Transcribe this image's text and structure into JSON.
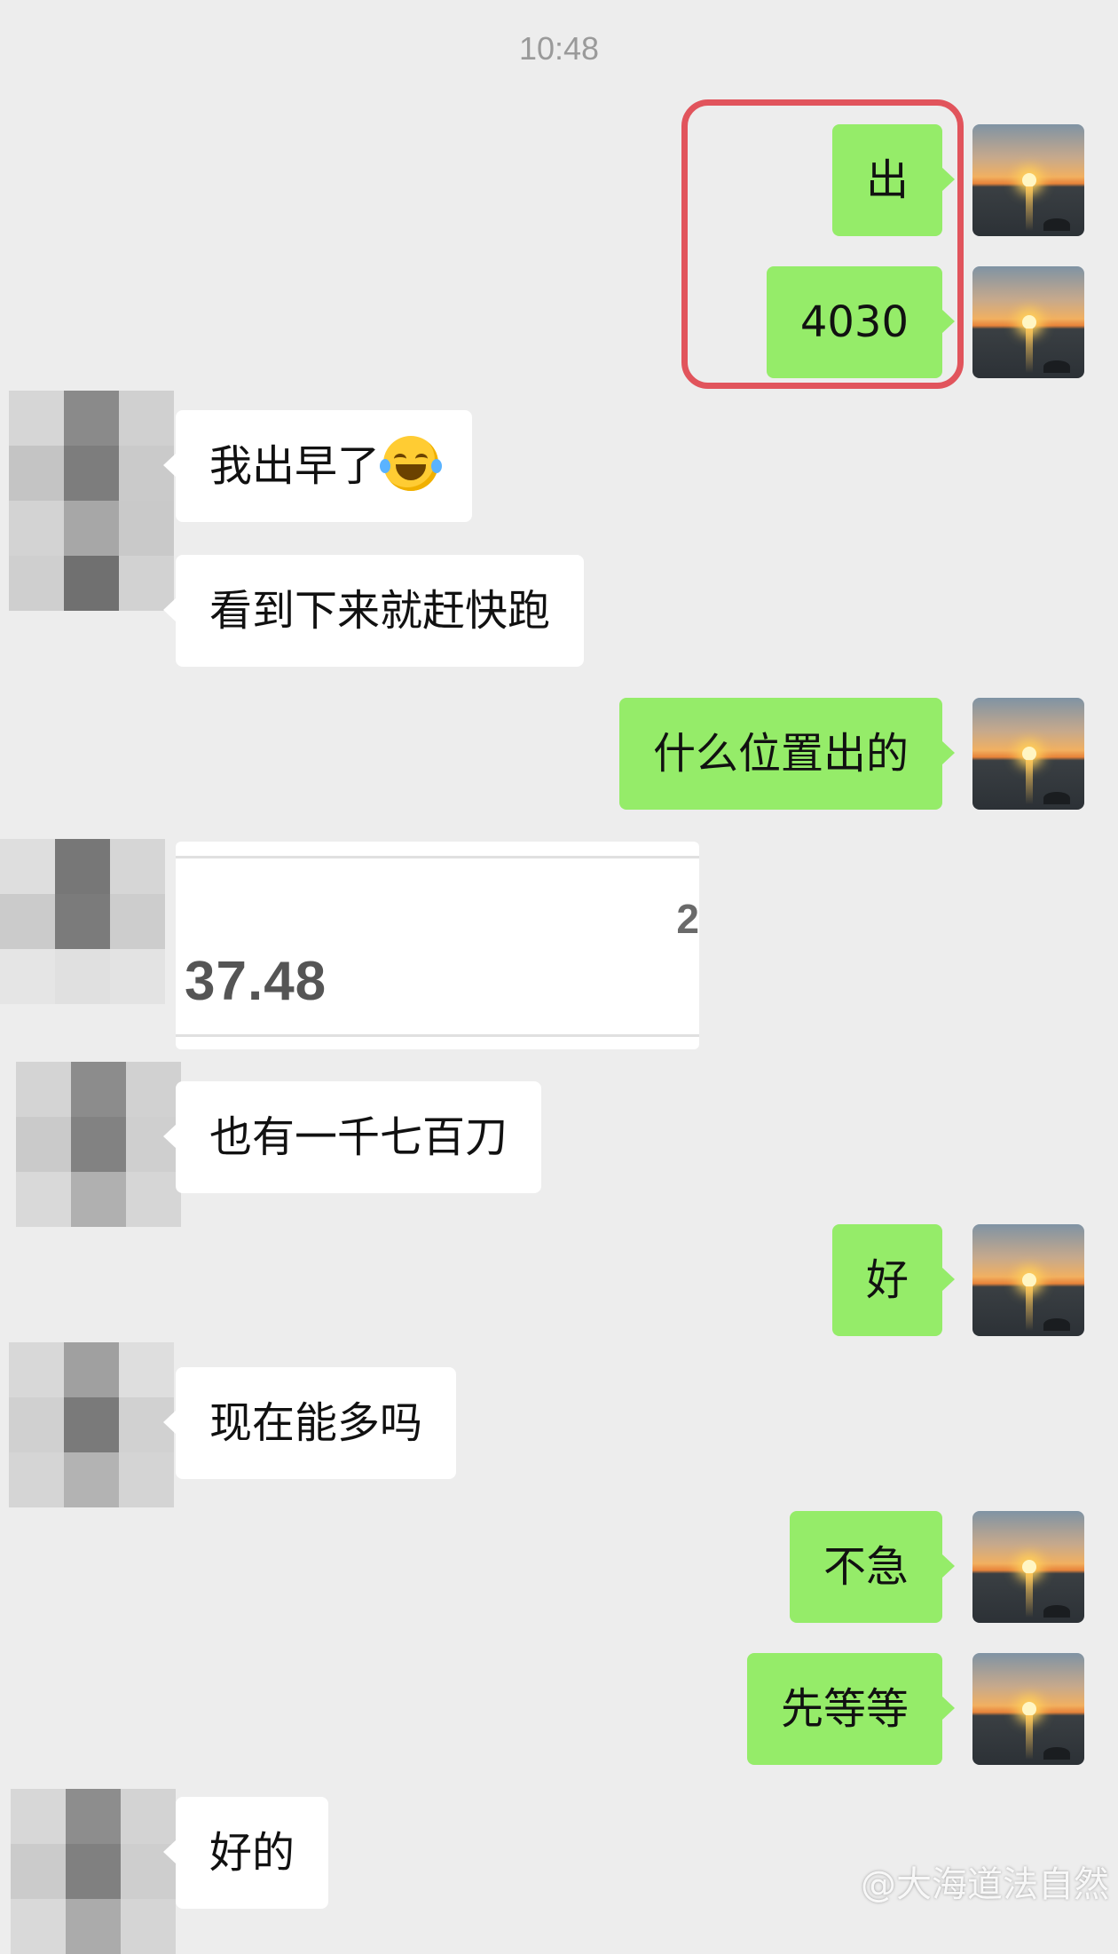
{
  "time_label": "10:48",
  "messages": [
    {
      "side": "me",
      "text": "出"
    },
    {
      "side": "me",
      "text": "4030"
    },
    {
      "side": "them",
      "text": "我出早了",
      "emoji": "face-with-tears-of-joy"
    },
    {
      "side": "them",
      "text": "看到下来就赶快跑"
    },
    {
      "side": "me",
      "text": "什么位置出的"
    },
    {
      "side": "them",
      "type": "image",
      "visible_digit": "2",
      "visible_amount": "37.48"
    },
    {
      "side": "them",
      "text": "也有一千七百刀"
    },
    {
      "side": "me",
      "text": "好"
    },
    {
      "side": "them",
      "text": "现在能多吗"
    },
    {
      "side": "me",
      "text": "不急"
    },
    {
      "side": "me",
      "text": "先等等"
    },
    {
      "side": "them",
      "text": "好的"
    }
  ],
  "watermark": "@大海道法自然",
  "colors": {
    "background": "#ededed",
    "my_bubble": "#95ec69",
    "their_bubble": "#ffffff",
    "highlight_box": "#e1545c",
    "timestamp": "#9a9a9a"
  }
}
